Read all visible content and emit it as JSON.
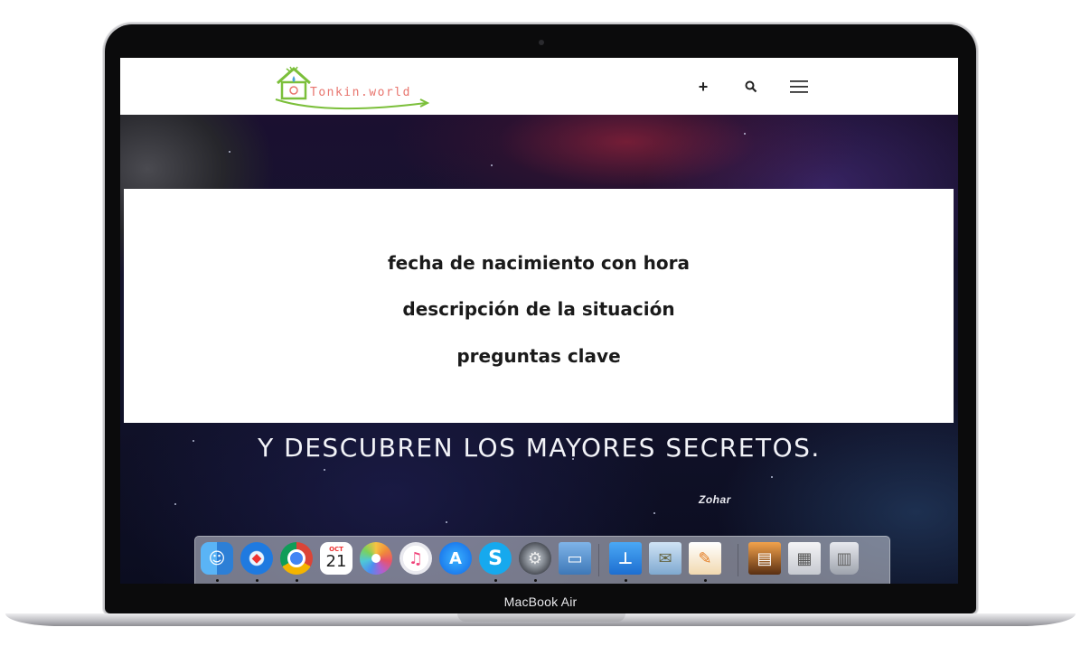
{
  "device": {
    "chin_label": "MacBook Air"
  },
  "site": {
    "logo_text": "Tonkin.world",
    "header_icons": [
      "plus-icon",
      "search-icon",
      "menu-icon"
    ]
  },
  "form_box": {
    "lines": [
      "fecha de nacimiento con hora",
      "descripción de la situación",
      "preguntas clave"
    ]
  },
  "quote": {
    "text": "Y DESCUBREN LOS MAYORES SECRETOS.",
    "author": "Zohar"
  },
  "dock": {
    "calendar_month": "OCT",
    "calendar_day": "21",
    "apps": [
      "finder-icon",
      "safari-icon",
      "chrome-icon",
      "calendar-icon",
      "photos-icon",
      "itunes-icon",
      "app-store-icon",
      "skype-icon",
      "system-preferences-icon",
      "preview-icon",
      "keynote-icon",
      "mail-icon",
      "pages-icon",
      "photo-stack-icon",
      "documents-stack-icon",
      "trash-icon"
    ]
  },
  "colors": {
    "accent_logo": "#e8756e",
    "logo_green": "#7bbf3a",
    "background_space": "#0b0d22"
  }
}
